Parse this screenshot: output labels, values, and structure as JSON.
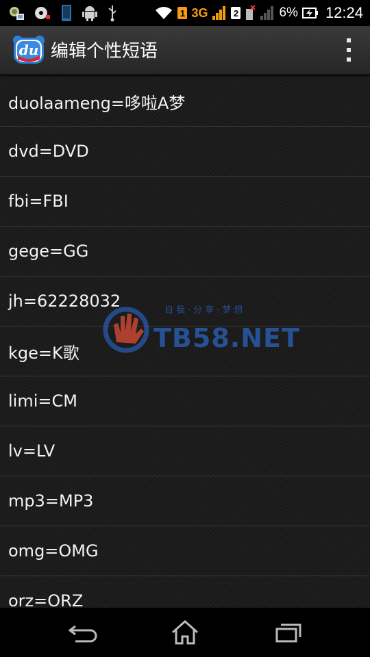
{
  "status_bar": {
    "icons_left": [
      "photo-notification-icon",
      "media-notification-icon",
      "phone-notification-icon",
      "android-debug-icon",
      "usb-icon"
    ],
    "sim1_badge": "1",
    "network_type": "3G",
    "sim2_badge": "2",
    "battery_percent": "6%",
    "time": "12:24"
  },
  "action_bar": {
    "app_icon_text": "du",
    "title": "编辑个性短语",
    "overflow_icon": "overflow-menu-icon"
  },
  "list": {
    "items": [
      "duolaameng=哆啦A梦",
      "dvd=DVD",
      "fbi=FBI",
      "gege=GG",
      "jh=62228032",
      "kge=K歌",
      "limi=CM",
      "lv=LV",
      "mp3=MP3",
      "omg=OMG",
      "orz=ORZ"
    ]
  },
  "watermark": {
    "text": "TB58.NET",
    "subtext": "自我·分享·梦想"
  },
  "nav_bar": {
    "back_icon": "back-icon",
    "home_icon": "home-icon",
    "recents_icon": "recent-apps-icon"
  },
  "colors": {
    "action_bar": "#2f2f2f",
    "network_3g": "#f39c12",
    "watermark": "#285aaa"
  }
}
